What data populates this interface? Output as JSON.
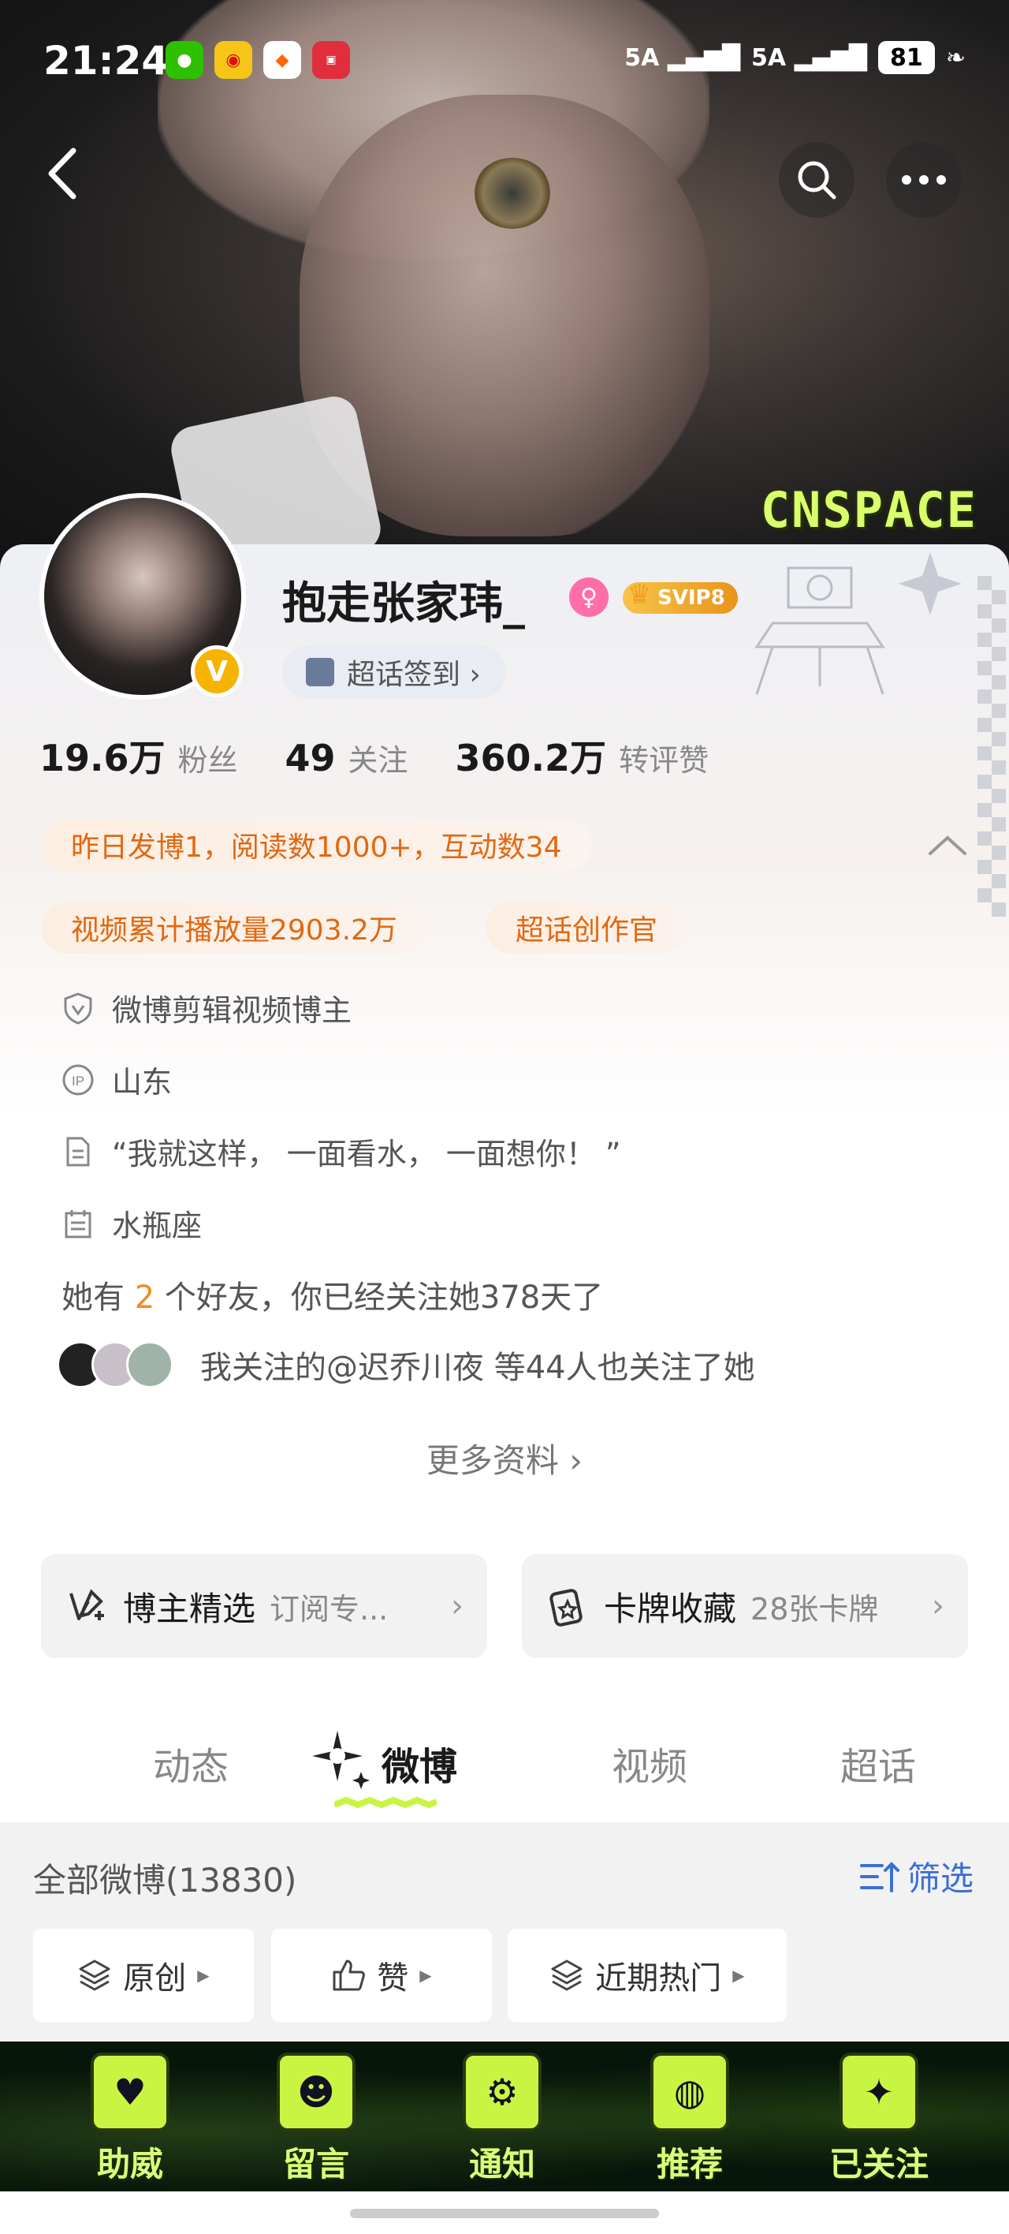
{
  "status_bar": {
    "time": "21:24",
    "signal_1": "5A",
    "signal_2": "5A",
    "battery": "81",
    "app_icons": [
      "wechat-icon",
      "weibo-icon",
      "taobao-icon",
      "xiaohongshu-icon"
    ]
  },
  "hero": {
    "watermark": "CNSPACE"
  },
  "profile": {
    "username": "抱走张家玮_",
    "gender_icon": "female-icon",
    "vip_label": "SVIP8",
    "checkin_label": "超话签到 ›",
    "verified_badge": "V"
  },
  "stats": [
    {
      "num": "19.6万",
      "label": "粉丝"
    },
    {
      "num": "49",
      "label": "关注"
    },
    {
      "num": "360.2万",
      "label": "转评赞"
    }
  ],
  "highlights": {
    "yesterday": "昨日发博1，阅读数1000+，互动数34",
    "video_plays": "视频累计播放量2903.2万",
    "creator_title": "超话创作官"
  },
  "info": {
    "verification": "微博剪辑视频博主",
    "ip_location": "山东",
    "bio": "“我就这样， 一面看水， 一面想你！ ”",
    "constellation": "水瓶座"
  },
  "friends": {
    "prefix": "她有",
    "count": "2",
    "suffix": "个好友，你已经关注她378天了",
    "mutual_follow": "我关注的@迟乔川夜 等44人也关注了她"
  },
  "more_info": "更多资料 ›",
  "tiles": [
    {
      "title": "博主精选",
      "sub": "订阅专..."
    },
    {
      "title": "卡牌收藏",
      "sub": "28张卡牌"
    }
  ],
  "tabs": [
    "动态",
    "微博",
    "视频",
    "超话"
  ],
  "feed": {
    "all_count": "全部微博(13830)",
    "filter": "筛选",
    "chips": [
      "原创",
      "赞",
      "近期热门"
    ]
  },
  "bottom_nav": [
    {
      "label": "助威",
      "icon": "heart-icon"
    },
    {
      "label": "留言",
      "icon": "astronaut-icon"
    },
    {
      "label": "通知",
      "icon": "rover-icon"
    },
    {
      "label": "推荐",
      "icon": "globe-icon"
    },
    {
      "label": "已关注",
      "icon": "cnspace-logo-icon"
    }
  ],
  "colors": {
    "accent_orange": "#e2680f",
    "link_blue": "#3a6fd6",
    "bottom_bar_green": "#c9f542"
  }
}
